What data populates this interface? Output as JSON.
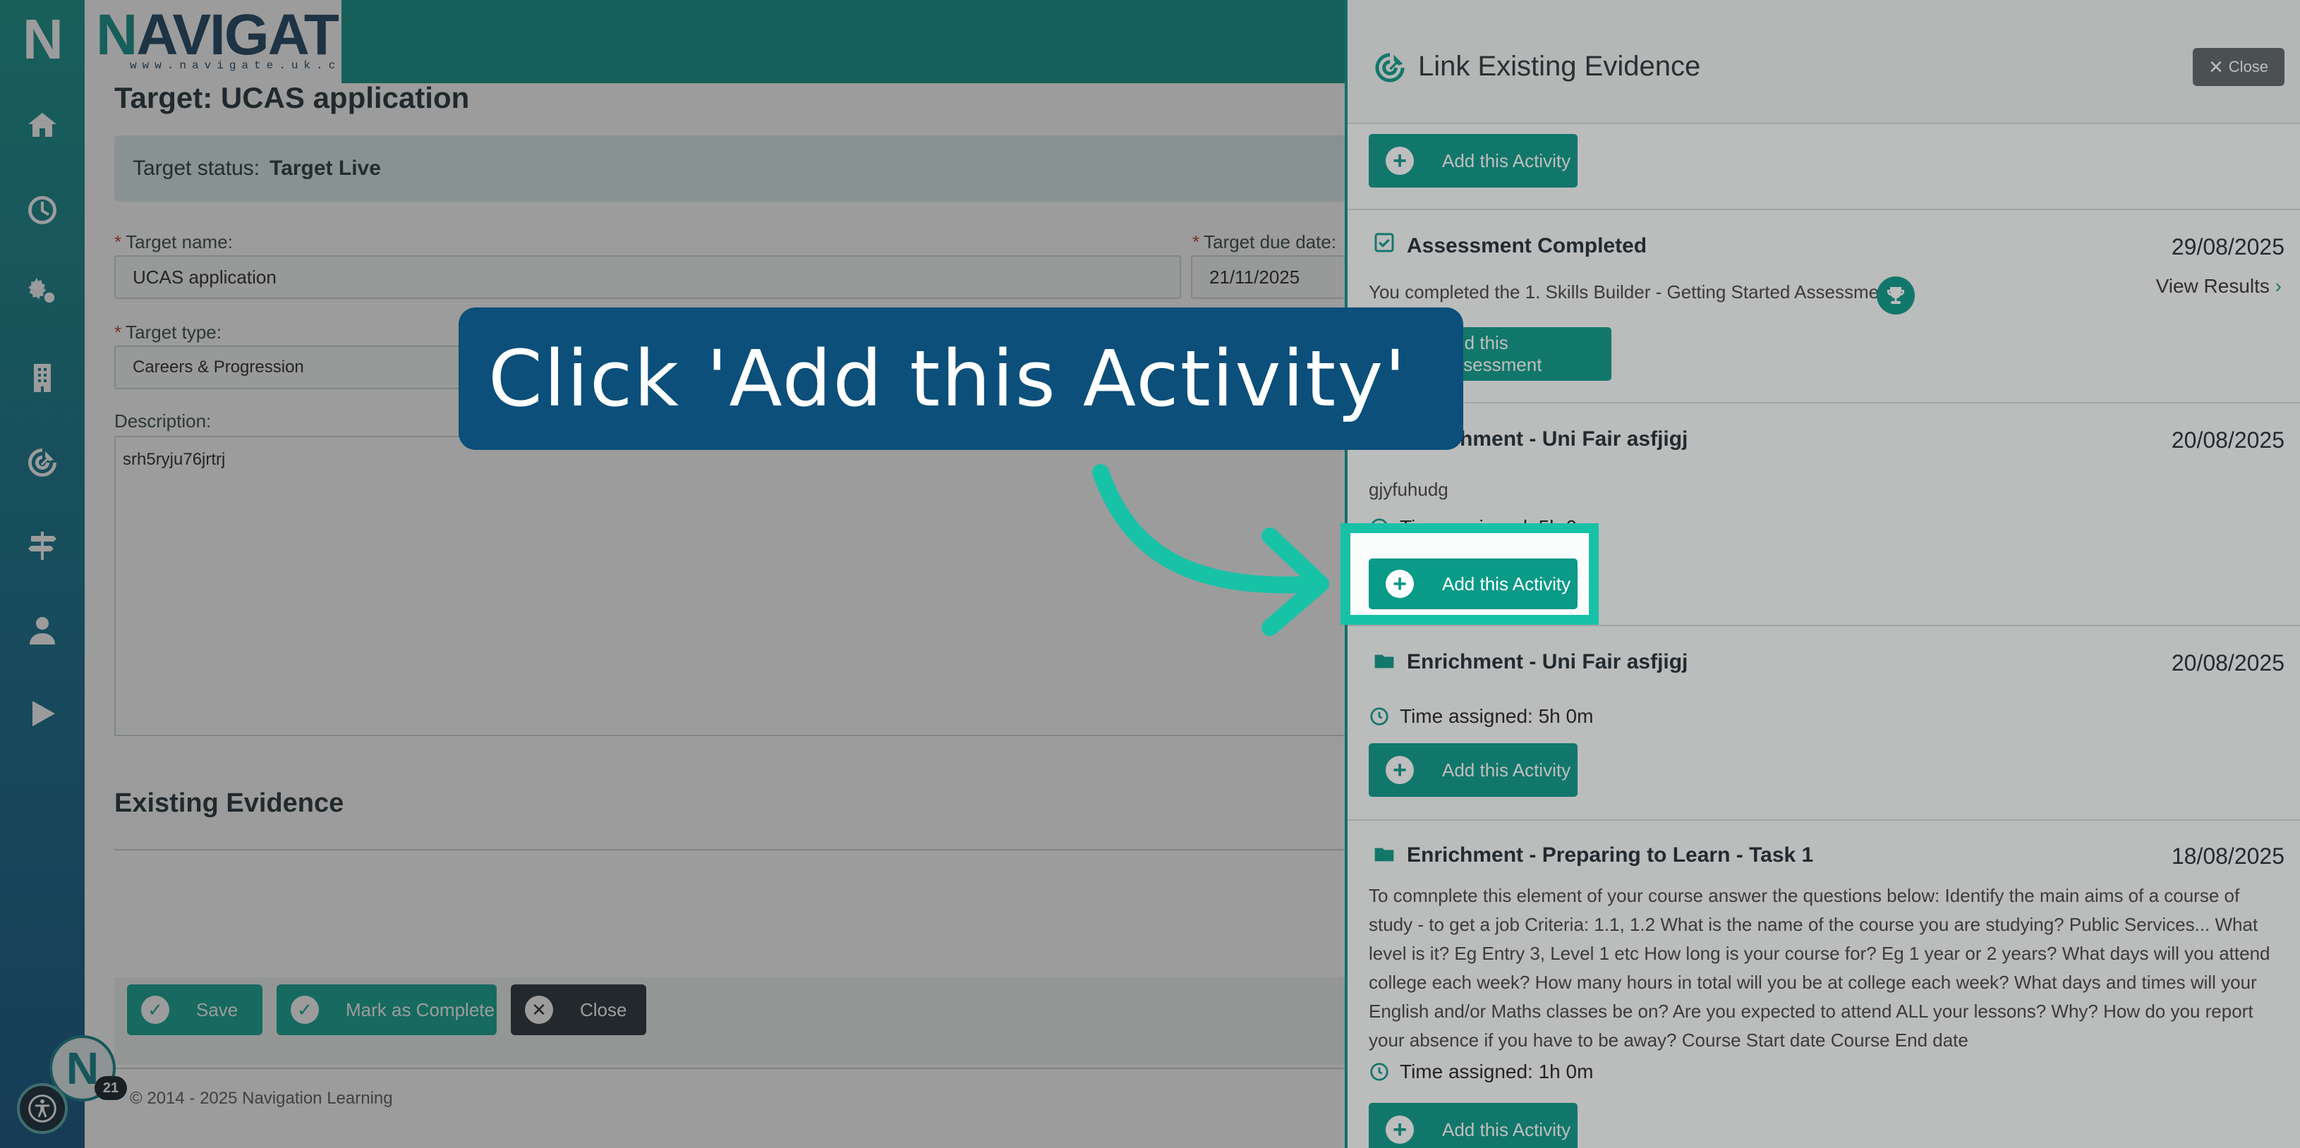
{
  "brand": {
    "word_first": "N",
    "word_rest": "AVIGATE",
    "url": "www.navigate.uk.com",
    "rail_logo": "N"
  },
  "nav": {
    "items": [
      {
        "name": "home-icon"
      },
      {
        "name": "clock-icon"
      },
      {
        "name": "gears-icon"
      },
      {
        "name": "building-icon"
      },
      {
        "name": "targets-icon"
      },
      {
        "name": "signpost-icon"
      },
      {
        "name": "user-icon"
      },
      {
        "name": "play-icon"
      }
    ]
  },
  "form": {
    "title": "Target: UCAS application",
    "status_label": "Target status:",
    "status_value": "Target Live",
    "name_label": "Target name:",
    "name_value": "UCAS application",
    "due_label": "Target due date:",
    "due_value": "21/11/2025",
    "type_label": "Target type:",
    "type_value": "Careers & Progression",
    "desc_label": "Description:",
    "desc_value": "srh5ryju76jrtrj",
    "required_mark": "*",
    "evidence_heading": "Existing Evidence",
    "save_label": "Save",
    "complete_label": "Mark as Complete",
    "close_label": "Close",
    "footer": "© 2014 - 2025 Navigation Learning"
  },
  "fab": {
    "letter": "N",
    "badge": "21"
  },
  "panel": {
    "title": "Link Existing Evidence",
    "close_label": "Close",
    "top_button": "Add this Activity",
    "cards": [
      {
        "title": "Assessment Completed",
        "date": "29/08/2025",
        "text": "You completed the 1. Skills Builder - Getting Started Assessment",
        "link": "View Results",
        "button": "Add this Assessment"
      },
      {
        "title": "Enrichment - Uni Fair asfjigj",
        "date": "20/08/2025",
        "text": "gjyfuhudg",
        "time": "Time assigned: 5h 0m",
        "button": "Add this Activity"
      },
      {
        "title": "Enrichment - Uni Fair asfjigj",
        "date": "20/08/2025",
        "time": "Time assigned: 5h 0m",
        "button": "Add this Activity"
      },
      {
        "title": "Enrichment - Preparing to Learn - Task 1",
        "date": "18/08/2025",
        "text": "To comnplete this element of your course answer the questions below: Identify the main aims of a course of study - to get a job Criteria: 1.1, 1.2 What is the name of the course you are studying? Public Services... What level is it? Eg Entry 3, Level 1 etc How long is your course for? Eg 1 year or 2 years? What days will you attend college each week? How many hours in total will you be at college each week? What days and times will your English and/or Maths classes be on? Are you expected to attend ALL your lessons? Why? How do you report your absence if you have to be away? Course Start date Course End date",
        "time": "Time assigned: 1h 0m",
        "button": "Add this Activity"
      }
    ]
  },
  "callout": {
    "text": "Click 'Add this Activity'"
  },
  "colors": {
    "teal": "#0a9a88",
    "highlight": "#18c2a6",
    "callout": "#0b4f7a",
    "dark": "#1f2a30"
  }
}
